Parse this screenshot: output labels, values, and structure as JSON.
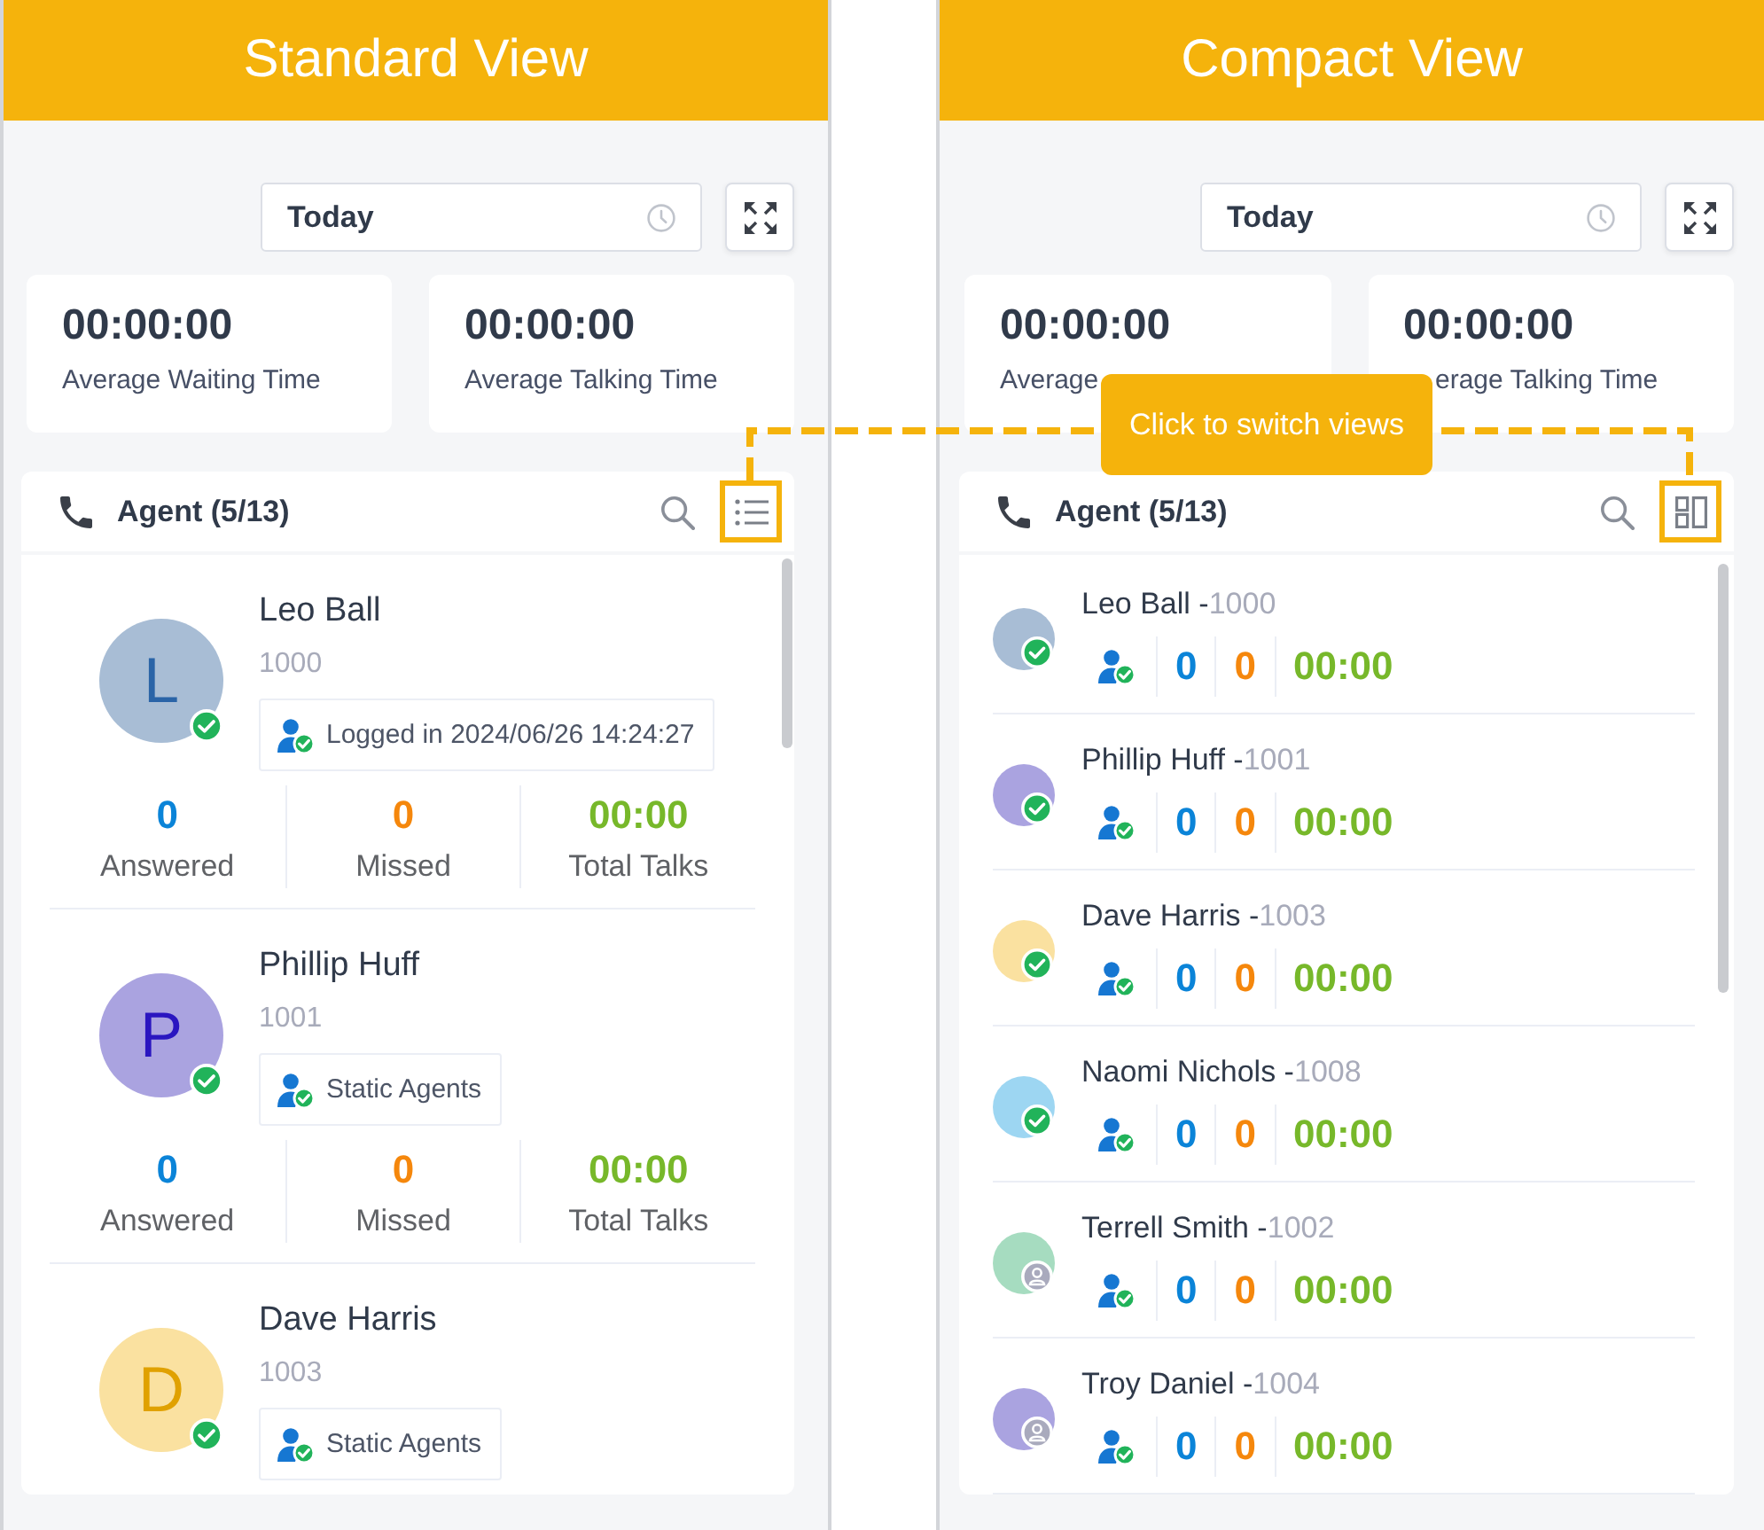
{
  "panels": [
    {
      "kind": "standard",
      "title": "Standard View",
      "date_filter": "Today",
      "stats": [
        {
          "value": "00:00:00",
          "label": "Average Waiting Time"
        },
        {
          "value": "00:00:00",
          "label": "Average Talking Time"
        }
      ],
      "agent_list": {
        "title": "Agent (5/13)",
        "toggle_highlighted": true,
        "agents": [
          {
            "initial": "L",
            "color": "#a8bdd5",
            "name": "Leo Ball",
            "extension": "1000",
            "available": true,
            "tag": "Logged in 2024/06/26 14:24:27",
            "stats": [
              {
                "kind": "answered",
                "value": "0",
                "label": "Answered"
              },
              {
                "kind": "missed",
                "value": "0",
                "label": "Missed"
              },
              {
                "kind": "talk_time",
                "value": "00:00",
                "label": "Total Talks"
              }
            ]
          },
          {
            "initial": "P",
            "color": "#aaa3e0",
            "name": "Phillip Huff",
            "extension": "1001",
            "available": true,
            "tag": "Static Agents",
            "stats": [
              {
                "kind": "answered",
                "value": "0",
                "label": "Answered"
              },
              {
                "kind": "missed",
                "value": "0",
                "label": "Missed"
              },
              {
                "kind": "talk_time",
                "value": "00:00",
                "label": "Total Talks"
              }
            ]
          },
          {
            "initial": "D",
            "color": "#fae1a0",
            "name": "Dave Harris",
            "extension": "1003",
            "available": true,
            "tag": "Static Agents"
          }
        ]
      }
    },
    {
      "kind": "compact",
      "title": "Compact View",
      "date_filter": "Today",
      "stats": [
        {
          "value": "00:00:00",
          "label": "Average"
        },
        {
          "value": "00:00:00",
          "label": "erage Talking Time",
          "cut_start": true
        }
      ],
      "agent_list": {
        "title": "Agent (5/13)",
        "toggle_highlighted": true,
        "agents": [
          {
            "color": "#a8bdd5",
            "name": "Leo Ball -",
            "extension": "1000",
            "available": true,
            "stats": [
              {
                "kind": "answered",
                "value": "0"
              },
              {
                "kind": "missed",
                "value": "0"
              },
              {
                "kind": "talk_time",
                "value": "00:00"
              }
            ]
          },
          {
            "color": "#aaa3e0",
            "name": "Phillip Huff -",
            "extension": "1001",
            "available": true,
            "stats": [
              {
                "kind": "answered",
                "value": "0"
              },
              {
                "kind": "missed",
                "value": "0"
              },
              {
                "kind": "talk_time",
                "value": "00:00"
              }
            ]
          },
          {
            "color": "#fae1a0",
            "name": "Dave Harris -",
            "extension": "1003",
            "available": true,
            "stats": [
              {
                "kind": "answered",
                "value": "0"
              },
              {
                "kind": "missed",
                "value": "0"
              },
              {
                "kind": "talk_time",
                "value": "00:00"
              }
            ]
          },
          {
            "color": "#9dd6f2",
            "name": "Naomi Nichols -",
            "extension": "1008",
            "available": true,
            "stats": [
              {
                "kind": "answered",
                "value": "0"
              },
              {
                "kind": "missed",
                "value": "0"
              },
              {
                "kind": "talk_time",
                "value": "00:00"
              }
            ]
          },
          {
            "color": "#a6dcc0",
            "name": "Terrell Smith -",
            "extension": "1002",
            "available": false,
            "stats": [
              {
                "kind": "answered",
                "value": "0"
              },
              {
                "kind": "missed",
                "value": "0"
              },
              {
                "kind": "talk_time",
                "value": "00:00"
              }
            ]
          },
          {
            "color": "#aaa3e0",
            "name": "Troy Daniel -",
            "extension": "1004",
            "available": false,
            "stats": [
              {
                "kind": "answered",
                "value": "0"
              },
              {
                "kind": "missed",
                "value": "0"
              },
              {
                "kind": "talk_time",
                "value": "00:00"
              }
            ]
          }
        ]
      }
    }
  ],
  "callout": {
    "text": "Click to switch views"
  }
}
